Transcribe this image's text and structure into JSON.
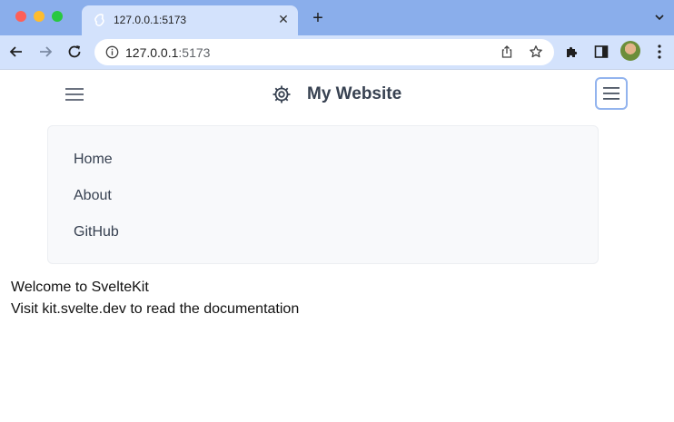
{
  "browser": {
    "tab": {
      "title": "127.0.0.1:5173"
    },
    "address": {
      "host": "127.0.0.1",
      "port": ":5173"
    }
  },
  "site": {
    "title": "My Website",
    "menu_items": [
      "Home",
      "About",
      "GitHub"
    ]
  },
  "content": {
    "heading": "Welcome to SvelteKit",
    "subtext": "Visit kit.svelte.dev to read the documentation"
  }
}
